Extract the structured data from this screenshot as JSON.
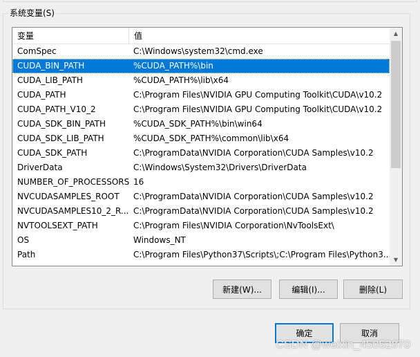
{
  "group": {
    "title": "系统变量(S)"
  },
  "list": {
    "headers": {
      "name": "变量",
      "value": "值"
    },
    "rows": [
      {
        "name": "ComSpec",
        "value": "C:\\Windows\\system32\\cmd.exe"
      },
      {
        "name": "CUDA_BIN_PATH",
        "value": "%CUDA_PATH%\\bin"
      },
      {
        "name": "CUDA_LIB_PATH",
        "value": "%CUDA_PATH%\\lib\\x64"
      },
      {
        "name": "CUDA_PATH",
        "value": "C:\\Program Files\\NVIDIA GPU Computing Toolkit\\CUDA\\v10.2"
      },
      {
        "name": "CUDA_PATH_V10_2",
        "value": "C:\\Program Files\\NVIDIA GPU Computing Toolkit\\CUDA\\v10.2"
      },
      {
        "name": "CUDA_SDK_BIN_PATH",
        "value": "%CUDA_SDK_PATH%\\bin\\win64"
      },
      {
        "name": "CUDA_SDK_LIB_PATH",
        "value": "%CUDA_SDK_PATH%\\common\\lib\\x64"
      },
      {
        "name": "CUDA_SDK_PATH",
        "value": "C:\\ProgramData\\NVIDIA Corporation\\CUDA Samples\\v10.2"
      },
      {
        "name": "DriverData",
        "value": "C:\\Windows\\System32\\Drivers\\DriverData"
      },
      {
        "name": "NUMBER_OF_PROCESSORS",
        "value": "16"
      },
      {
        "name": "NVCUDASAMPLES_ROOT",
        "value": "C:\\ProgramData\\NVIDIA Corporation\\CUDA Samples\\v10.2"
      },
      {
        "name": "NVCUDASAMPLES10_2_R...",
        "value": "C:\\ProgramData\\NVIDIA Corporation\\CUDA Samples\\v10.2"
      },
      {
        "name": "NVTOOLSEXT_PATH",
        "value": "C:\\Program Files\\NVIDIA Corporation\\NvToolsExt\\"
      },
      {
        "name": "OS",
        "value": "Windows_NT"
      },
      {
        "name": "Path",
        "value": "C:\\Program Files\\Python37\\Scripts\\;C:\\Program Files\\Python3..."
      }
    ],
    "selected_index": 1
  },
  "buttons": {
    "new": "新建(W)...",
    "edit": "编辑(I)...",
    "delete": "删除(L)",
    "ok": "确定",
    "cancel": "取消"
  },
  "icons": {
    "scroll_up": "scroll-up-arrow-icon",
    "scroll_down": "scroll-down-arrow-icon"
  },
  "colors": {
    "selection": "#0078d7",
    "dialog_bg": "#f0f0f0"
  },
  "watermark": "CSDN @weixin_45052870"
}
